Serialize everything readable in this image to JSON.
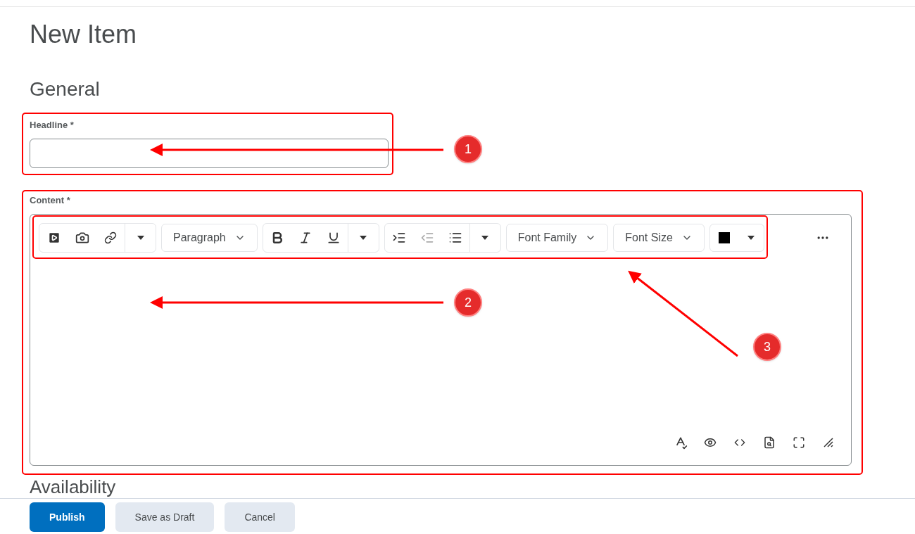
{
  "page_title": "New Item",
  "section": "General",
  "headline": {
    "label": "Headline *"
  },
  "content": {
    "label": "Content *"
  },
  "toolbar": [
    {
      "kind": "dropdown",
      "label": "Paragraph"
    },
    {
      "kind": "dropdown",
      "label": "Font Family"
    },
    {
      "kind": "dropdown",
      "label": "Font Size"
    },
    {
      "kind": "color",
      "color": "#000000"
    }
  ],
  "next_section": "Availability",
  "buttons": [
    {
      "label": "Publish",
      "kind": "primary"
    },
    {
      "label": "Save as Draft",
      "kind": "secondary"
    },
    {
      "label": "Cancel",
      "kind": "secondary"
    }
  ],
  "callouts": [
    {
      "number": "1"
    },
    {
      "number": "2"
    },
    {
      "number": "3"
    }
  ]
}
